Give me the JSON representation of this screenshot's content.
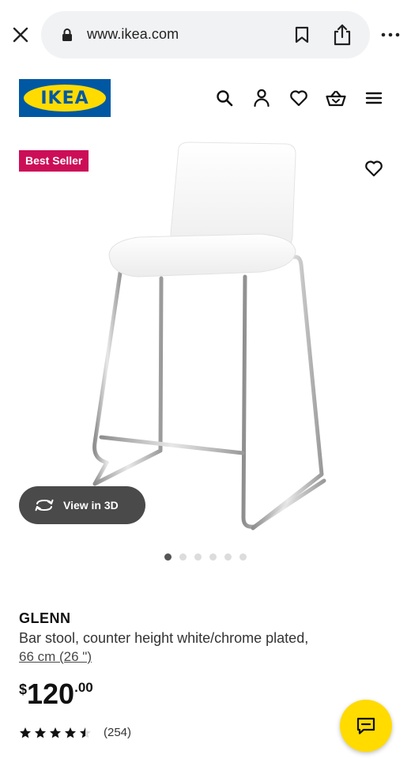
{
  "browser": {
    "url": "www.ikea.com",
    "close_icon": "close-icon",
    "lock_icon": "lock-icon",
    "bookmark_icon": "bookmark-icon",
    "share_icon": "share-icon",
    "more_icon": "more-icon"
  },
  "header": {
    "logo_text": "IKEA",
    "icons": [
      "search-icon",
      "account-icon",
      "heart-icon",
      "basket-icon",
      "menu-icon"
    ]
  },
  "product": {
    "badge": "Best Seller",
    "view3d_label": "View in 3D",
    "image_count": 6,
    "active_image": 1,
    "name": "GLENN",
    "description": "Bar stool, counter height white/chrome plated,",
    "size": "66 cm (26 \")",
    "price": {
      "currency": "$",
      "main": "120",
      "decimal": ".00"
    },
    "rating": {
      "value": 4.5,
      "max": 5,
      "reviews": "(254)"
    }
  },
  "colors": {
    "ikea_blue": "#0058a3",
    "ikea_yellow": "#ffdb00",
    "badge_red": "#cc0e57",
    "dot_active": "#555555"
  }
}
